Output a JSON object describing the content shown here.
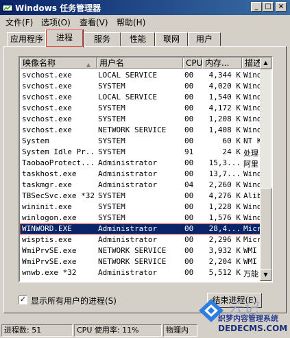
{
  "window": {
    "title": "Windows 任务管理器",
    "min_glyph": "_",
    "max_glyph": "□",
    "close_glyph": "×"
  },
  "menu": [
    "文件(F)",
    "选项(O)",
    "查看(V)",
    "帮助(H)"
  ],
  "tabs": [
    {
      "label": "应用程序",
      "active": false
    },
    {
      "label": "进程",
      "active": true
    },
    {
      "label": "服务",
      "active": false
    },
    {
      "label": "性能",
      "active": false
    },
    {
      "label": "联网",
      "active": false
    },
    {
      "label": "用户",
      "active": false
    }
  ],
  "columns": [
    "映像名称",
    "用户名",
    "CPU",
    "内存...",
    "描述"
  ],
  "processes": [
    {
      "name": "svchost.exe",
      "user": "LOCAL SERVICE",
      "cpu": "00",
      "mem": "4,344 K",
      "desc": "Wind"
    },
    {
      "name": "svchost.exe",
      "user": "SYSTEM",
      "cpu": "00",
      "mem": "4,020 K",
      "desc": "Wind"
    },
    {
      "name": "svchost.exe",
      "user": "LOCAL SERVICE",
      "cpu": "00",
      "mem": "1,540 K",
      "desc": "Wind"
    },
    {
      "name": "svchost.exe",
      "user": "SYSTEM",
      "cpu": "00",
      "mem": "4,172 K",
      "desc": "Wind"
    },
    {
      "name": "svchost.exe",
      "user": "SYSTEM",
      "cpu": "00",
      "mem": "1,208 K",
      "desc": "Wind"
    },
    {
      "name": "svchost.exe",
      "user": "NETWORK SERVICE",
      "cpu": "00",
      "mem": "1,408 K",
      "desc": "Wind"
    },
    {
      "name": "System",
      "user": "SYSTEM",
      "cpu": "00",
      "mem": "60 K",
      "desc": "NT K"
    },
    {
      "name": "System Idle Pr...",
      "user": "SYSTEM",
      "cpu": "91",
      "mem": "24 K",
      "desc": "处理"
    },
    {
      "name": "TaobaoProtect....",
      "user": "Administrator",
      "cpu": "00",
      "mem": "15,3...",
      "desc": "阿里"
    },
    {
      "name": "taskhost.exe",
      "user": "Administrator",
      "cpu": "00",
      "mem": "13,7...",
      "desc": "Wind"
    },
    {
      "name": "taskmgr.exe",
      "user": "Administrator",
      "cpu": "04",
      "mem": "2,260 K",
      "desc": "Wind"
    },
    {
      "name": "TBSecSvc.exe *32",
      "user": "SYSTEM",
      "cpu": "00",
      "mem": "4,276 K",
      "desc": "Alib"
    },
    {
      "name": "wininit.exe",
      "user": "SYSTEM",
      "cpu": "00",
      "mem": "1,228 K",
      "desc": "Wind"
    },
    {
      "name": "winlogon.exe",
      "user": "SYSTEM",
      "cpu": "00",
      "mem": "1,576 K",
      "desc": "Wind"
    },
    {
      "name": "WINWORD.EXE",
      "user": "Administrator",
      "cpu": "00",
      "mem": "28,4...",
      "desc": "Micr",
      "selected": true
    },
    {
      "name": "wisptis.exe",
      "user": "Administrator",
      "cpu": "00",
      "mem": "2,296 K",
      "desc": "Micr"
    },
    {
      "name": "WmiPrvSE.exe",
      "user": "NETWORK SERVICE",
      "cpu": "00",
      "mem": "3,932 K",
      "desc": "WMI"
    },
    {
      "name": "WmiPrvSE.exe",
      "user": "NETWORK SERVICE",
      "cpu": "00",
      "mem": "2,204 K",
      "desc": "WMI"
    },
    {
      "name": "wnwb.exe *32",
      "user": "Administrator",
      "cpu": "00",
      "mem": "5,512 K",
      "desc": "万能"
    }
  ],
  "show_all_users": {
    "label": "显示所有用户的进程(S)",
    "checked": true,
    "mark": "✓"
  },
  "end_process_button": "结束进程(E)",
  "status": {
    "processes": "进程数: 51",
    "cpu": "CPU 使用率: 11%",
    "memory": "物理内"
  },
  "watermark": {
    "script": "云记",
    "line1": "织梦内容管理系统",
    "line2": "DEDECMS.COM"
  }
}
